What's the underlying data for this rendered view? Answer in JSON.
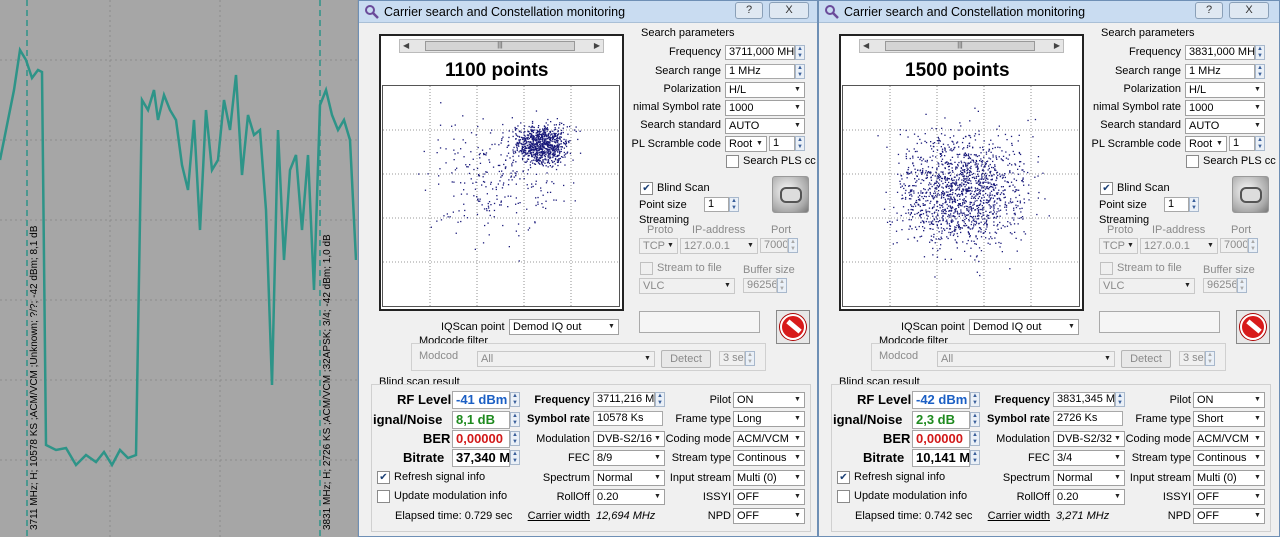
{
  "spectrum": {
    "markers": [
      "3711 MHz; H; 10578 KS ;ACM/VCM ;Unknown; ?/?; -42 dBm; 8,1 dB",
      "3831 MHz; H; 2726 KS ;ACM/VCM ;32APSK; 3/4; -42 dBm; 1,0 dB"
    ],
    "line_color": "#2e9488"
  },
  "windows": [
    {
      "title": "Carrier search and Constellation monitoring",
      "help": "?",
      "close": "X",
      "points_title": "1100 points",
      "constellation": {
        "points": 1100,
        "cluster": "tight",
        "dot_color": "#1a1a7a"
      },
      "search_params": {
        "heading": "Search parameters",
        "frequency_label": "Frequency",
        "frequency": "3711,000 MHz",
        "range_label": "Search range",
        "range": "1 MHz",
        "polarization_label": "Polarization",
        "polarization": "H/L",
        "symrate_label": "nimal Symbol rate",
        "symrate": "1000",
        "standard_label": "Search standard",
        "standard": "AUTO",
        "pls_label": "PL Scramble code",
        "pls_mode": "Root",
        "pls_value": "1",
        "search_pls_label": "Search PLS cc"
      },
      "blind_scan_label": "Blind Scan",
      "point_size_label": "Point size",
      "point_size": "1",
      "streaming": {
        "heading": "Streaming",
        "proto_label": "Proto",
        "ip_label": "IP-address",
        "port_label": "Port",
        "proto": "TCP",
        "ip": "127.0.0.1",
        "port": "7000",
        "stream_to_file": "Stream to file",
        "buffer_label": "Buffer size",
        "player": "VLC",
        "buffer": "96256"
      },
      "iqscan_label": "IQScan point",
      "iqscan": "Demod IQ out",
      "modcode": {
        "heading": "Modcode filter",
        "label": "Modcod",
        "value": "All",
        "detect": "Detect",
        "sec": "3 sec"
      },
      "result": {
        "heading": "Blind scan result",
        "rf_label": "RF Level",
        "rf": "-41 dBm",
        "sn_label": "ignal/Noise",
        "sn": "8,1 dB",
        "ber_label": "BER",
        "ber": "0,00000",
        "bitrate_label": "Bitrate",
        "bitrate": "37,340 M",
        "frequency_label": "Frequency",
        "frequency": "3711,216 M",
        "symrate_label": "Symbol rate",
        "symrate": "10578 Ks",
        "modulation_label": "Modulation",
        "modulation": "DVB-S2/16A",
        "fec_label": "FEC",
        "fec": "8/9",
        "spectrum_label": "Spectrum",
        "spectrum": "Normal",
        "rolloff_label": "RollOff",
        "rolloff": "0.20",
        "pilot_label": "Pilot",
        "pilot": "ON",
        "frame_label": "Frame type",
        "frame": "Long",
        "coding_label": "Coding mode",
        "coding": "ACM/VCM",
        "stream_type_label": "Stream type",
        "stream_type": "Continous",
        "input_label": "Input stream",
        "input": "Multi (0)",
        "issyi_label": "ISSYI",
        "issyi": "OFF",
        "npd_label": "NPD",
        "npd": "OFF",
        "refresh_label": "Refresh signal info",
        "update_label": "Update modulation info",
        "elapsed": "Elapsed time: 0.729 sec",
        "cw_label": "Carrier width",
        "cw": "12,694 MHz"
      }
    },
    {
      "title": "Carrier search and Constellation monitoring",
      "help": "?",
      "close": "X",
      "points_title": "1500 points",
      "constellation": {
        "points": 1500,
        "cluster": "wide",
        "dot_color": "#1a1a7a"
      },
      "search_params": {
        "heading": "Search parameters",
        "frequency_label": "Frequency",
        "frequency": "3831,000 MHz",
        "range_label": "Search range",
        "range": "1 MHz",
        "polarization_label": "Polarization",
        "polarization": "H/L",
        "symrate_label": "nimal Symbol rate",
        "symrate": "1000",
        "standard_label": "Search standard",
        "standard": "AUTO",
        "pls_label": "PL Scramble code",
        "pls_mode": "Root",
        "pls_value": "1",
        "search_pls_label": "Search PLS cc"
      },
      "blind_scan_label": "Blind Scan",
      "point_size_label": "Point size",
      "point_size": "1",
      "streaming": {
        "heading": "Streaming",
        "proto_label": "Proto",
        "ip_label": "IP-address",
        "port_label": "Port",
        "proto": "TCP",
        "ip": "127.0.0.1",
        "port": "7000",
        "stream_to_file": "Stream to file",
        "buffer_label": "Buffer size",
        "player": "VLC",
        "buffer": "96256"
      },
      "iqscan_label": "IQScan point",
      "iqscan": "Demod IQ out",
      "modcode": {
        "heading": "Modcode filter",
        "label": "Modcod",
        "value": "All",
        "detect": "Detect",
        "sec": "3 sec"
      },
      "result": {
        "heading": "Blind scan result",
        "rf_label": "RF Level",
        "rf": "-42 dBm",
        "sn_label": "ignal/Noise",
        "sn": "2,3 dB",
        "ber_label": "BER",
        "ber": "0,00000",
        "bitrate_label": "Bitrate",
        "bitrate": "10,141 M",
        "frequency_label": "Frequency",
        "frequency": "3831,345 M",
        "symrate_label": "Symbol rate",
        "symrate": "2726 Ks",
        "modulation_label": "Modulation",
        "modulation": "DVB-S2/32A",
        "fec_label": "FEC",
        "fec": "3/4",
        "spectrum_label": "Spectrum",
        "spectrum": "Normal",
        "rolloff_label": "RollOff",
        "rolloff": "0.20",
        "pilot_label": "Pilot",
        "pilot": "ON",
        "frame_label": "Frame type",
        "frame": "Short",
        "coding_label": "Coding mode",
        "coding": "ACM/VCM",
        "stream_type_label": "Stream type",
        "stream_type": "Continous",
        "input_label": "Input stream",
        "input": "Multi (0)",
        "issyi_label": "ISSYI",
        "issyi": "OFF",
        "npd_label": "NPD",
        "npd": "OFF",
        "refresh_label": "Refresh signal info",
        "update_label": "Update modulation info",
        "elapsed": "Elapsed time: 0.742 sec",
        "cw_label": "Carrier width",
        "cw": "3,271 MHz"
      }
    }
  ]
}
